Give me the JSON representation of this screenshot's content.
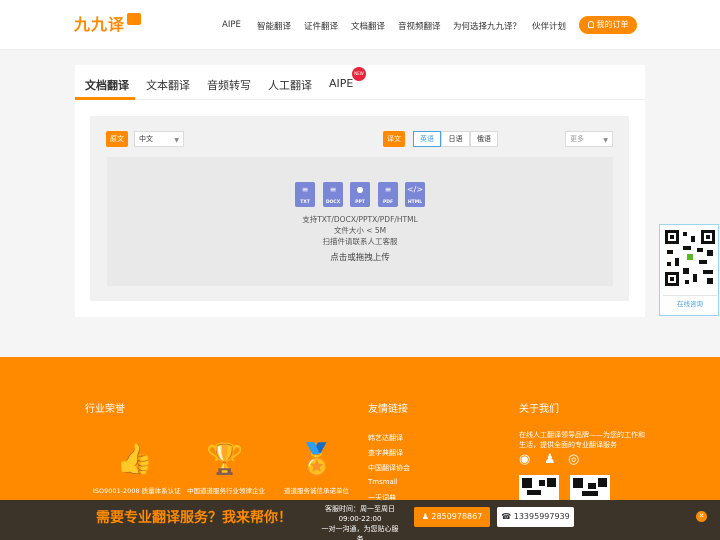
{
  "header": {
    "logo": {
      "text": "九九译",
      "subtitle": ""
    },
    "nav": [
      "AIPE",
      "智能翻译",
      "证件翻译",
      "文档翻译",
      "音视频翻译",
      "为何选择九九译？",
      "伙伴计划"
    ],
    "order_button": "我的订单"
  },
  "tabs": [
    "文档翻译",
    "文本翻译",
    "音频转写",
    "人工翻译",
    "AIPE"
  ],
  "tab_badge": "NEW",
  "source": {
    "badge": "原文",
    "selected": "中文"
  },
  "target": {
    "badge": "译文",
    "langs": [
      "英语",
      "日语",
      "俄语"
    ],
    "more": "更多"
  },
  "upload": {
    "file_types": [
      "TXT",
      "DOCX",
      "PPT",
      "PDF",
      "HTML"
    ],
    "supported": "支持TXT/DOCX/PPTX/PDF/HTML",
    "size": "文件大小 < 5M",
    "scan": "扫描件请联系人工客服",
    "action": "点击或拖拽上传"
  },
  "side_qr": {
    "label": "在线咨询"
  },
  "footer": {
    "honors_title": "行业荣誉",
    "awards": [
      "ISO9001-2008 质量体系认证",
      "中国道道服务行业领律企业",
      "道道服务诚信承诺单位"
    ],
    "links_title": "友情链接",
    "links": [
      "韩艺达翻译",
      "查字典翻译",
      "中国翻译协会",
      "Tmsmall",
      "一天词典"
    ],
    "about_title": "关于我们",
    "about_text": "在线人工翻译领导品牌——为您的工作和生活，提供全面的专业翻译服务"
  },
  "bottom_bar": {
    "slogan": "需要专业翻译服务？我来帮你！",
    "hours_line1": "客服时间：周一至周日",
    "hours_line2": "09:00-22:00",
    "hours_line3": "一对一沟通，为您贴心服务",
    "qq": "2850978867",
    "phone": "13395997939"
  },
  "colors": {
    "accent": "#ff8a00",
    "new_badge": "#e8253c",
    "file_icon": "#7a86d6"
  }
}
